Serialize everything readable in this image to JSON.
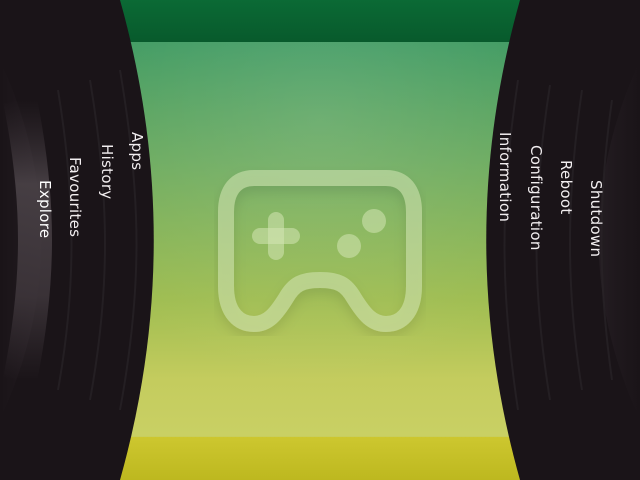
{
  "left_menu": {
    "items": [
      {
        "label": "Apps"
      },
      {
        "label": "History"
      },
      {
        "label": "Favourites"
      },
      {
        "label": "Explore"
      }
    ]
  },
  "right_menu": {
    "items": [
      {
        "label": "Information"
      },
      {
        "label": "Configuration"
      },
      {
        "label": "Reboot"
      },
      {
        "label": "Shutdown"
      }
    ]
  },
  "center": {
    "icon": "gamepad-icon"
  },
  "colors": {
    "panel": "#1a1418",
    "top_band": "#0a5f30",
    "bottom_band": "#c2bd22",
    "text": "#f2eef0"
  }
}
